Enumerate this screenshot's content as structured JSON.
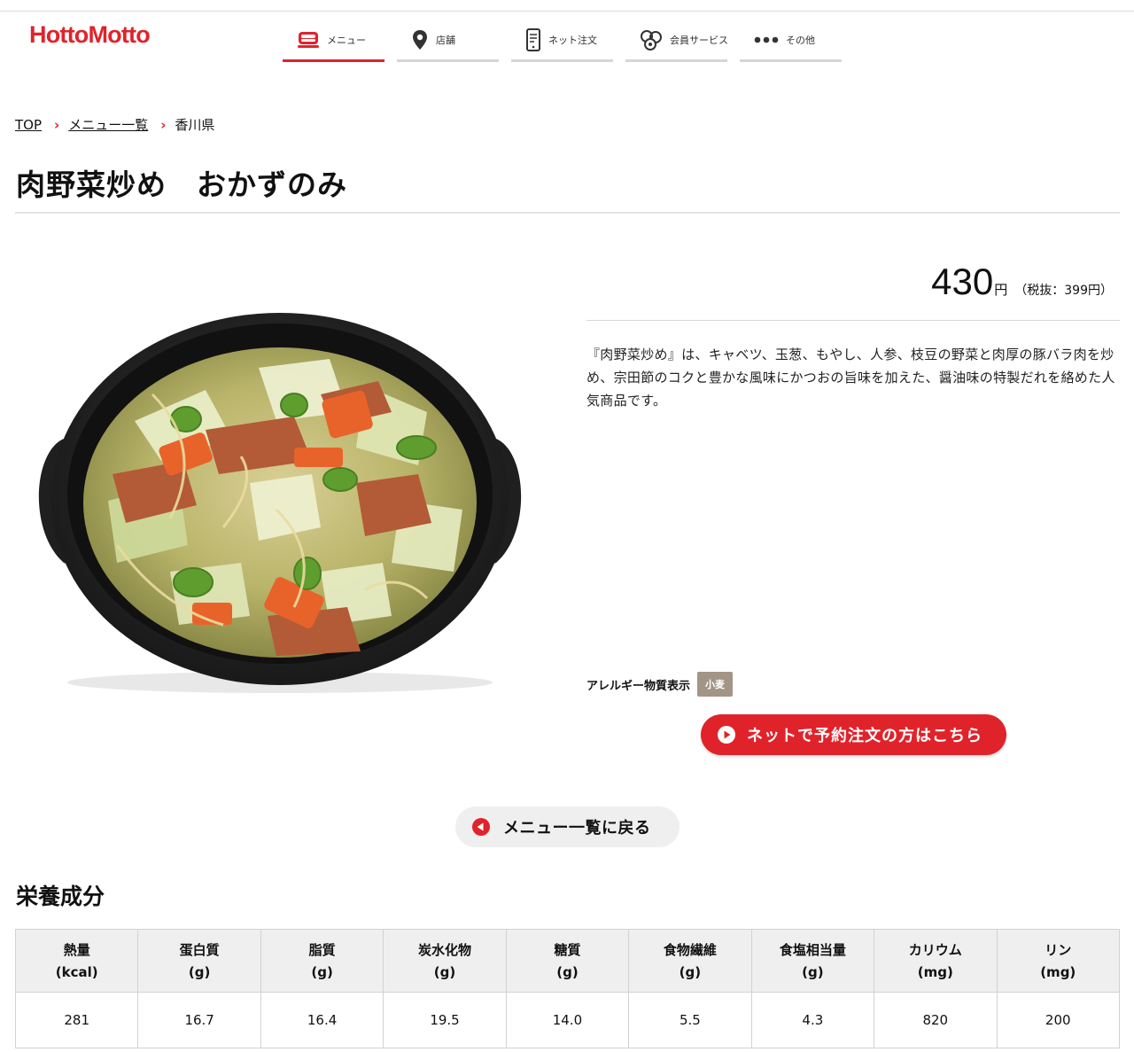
{
  "header": {
    "logo_text": "HottoMotto",
    "brand_color": "#e0232b",
    "nav": [
      {
        "label": "メニュー",
        "icon": "bento-icon",
        "active": true
      },
      {
        "label": "店舗",
        "icon": "map-pin-icon",
        "active": false
      },
      {
        "label": "ネット注文",
        "icon": "smartphone-icon",
        "active": false
      },
      {
        "label": "会員サービス",
        "icon": "coins-icon",
        "active": false
      },
      {
        "label": "その他",
        "icon": "more-dots-icon",
        "active": false
      }
    ]
  },
  "breadcrumb": {
    "items": [
      "TOP",
      "メニュー一覧"
    ],
    "current": "香川県"
  },
  "product": {
    "title": "肉野菜炒め　おかずのみ",
    "image_alt": "肉野菜炒め",
    "price": "430",
    "price_unit": "円",
    "price_tax_note": "（税抜：399円）",
    "description": "『肉野菜炒め』は、キャベツ、玉葱、もやし、人参、枝豆の野菜と肉厚の豚バラ肉を炒め、宗田節のコクと豊かな風味にかつおの旨味を加えた、醤油味の特製だれを絡めた人気商品です。",
    "allergy_label": "アレルギー物質表示",
    "allergens": [
      "小麦"
    ],
    "order_button_label": "ネットで予約注文の方はこちら",
    "back_button_label": "メニュー一覧に戻る"
  },
  "nutrition": {
    "title": "栄養成分",
    "columns": [
      {
        "name": "熱量",
        "unit": "(kcal)",
        "value": "281"
      },
      {
        "name": "蛋白質",
        "unit": "(g)",
        "value": "16.7"
      },
      {
        "name": "脂質",
        "unit": "(g)",
        "value": "16.4"
      },
      {
        "name": "炭水化物",
        "unit": "(g)",
        "value": "19.5"
      },
      {
        "name": "糖質",
        "unit": "(g)",
        "value": "14.0"
      },
      {
        "name": "食物繊維",
        "unit": "(g)",
        "value": "5.5"
      },
      {
        "name": "食塩相当量",
        "unit": "(g)",
        "value": "4.3"
      },
      {
        "name": "カリウム",
        "unit": "(mg)",
        "value": "820"
      },
      {
        "name": "リン",
        "unit": "(mg)",
        "value": "200"
      }
    ]
  }
}
